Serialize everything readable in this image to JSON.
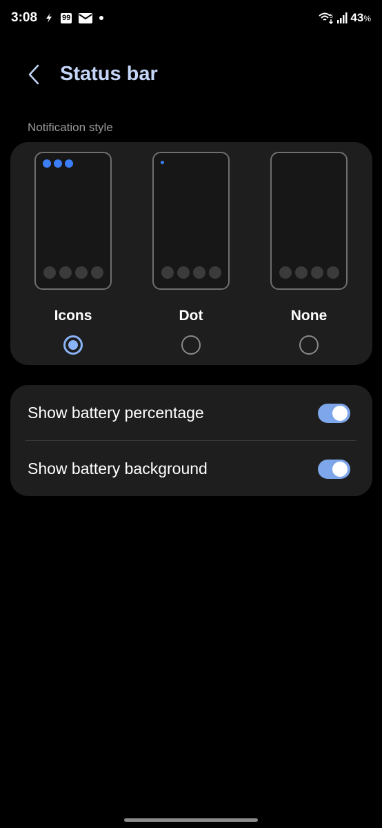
{
  "status_bar": {
    "time": "3:08",
    "badge": "99",
    "battery": "43",
    "battery_unit": "%",
    "network": "5"
  },
  "header": {
    "title": "Status bar"
  },
  "notification_style": {
    "label": "Notification style",
    "options": [
      {
        "label": "Icons",
        "selected": true
      },
      {
        "label": "Dot",
        "selected": false
      },
      {
        "label": "None",
        "selected": false
      }
    ]
  },
  "toggles": [
    {
      "label": "Show battery percentage",
      "on": true
    },
    {
      "label": "Show battery background",
      "on": true
    }
  ],
  "colors": {
    "accent": "#8ab4f8",
    "title": "#c5d5f7",
    "notif_dot": "#3b7ef6",
    "switch_on": "#7ea6ea",
    "card_bg": "#1e1e1e"
  },
  "icons": {
    "back": "chevron-left-icon",
    "status_left": [
      "flash-icon",
      "quote-badge-icon",
      "mail-icon",
      "dot-icon"
    ],
    "status_right": [
      "wifi-icon",
      "signal-icon"
    ]
  }
}
